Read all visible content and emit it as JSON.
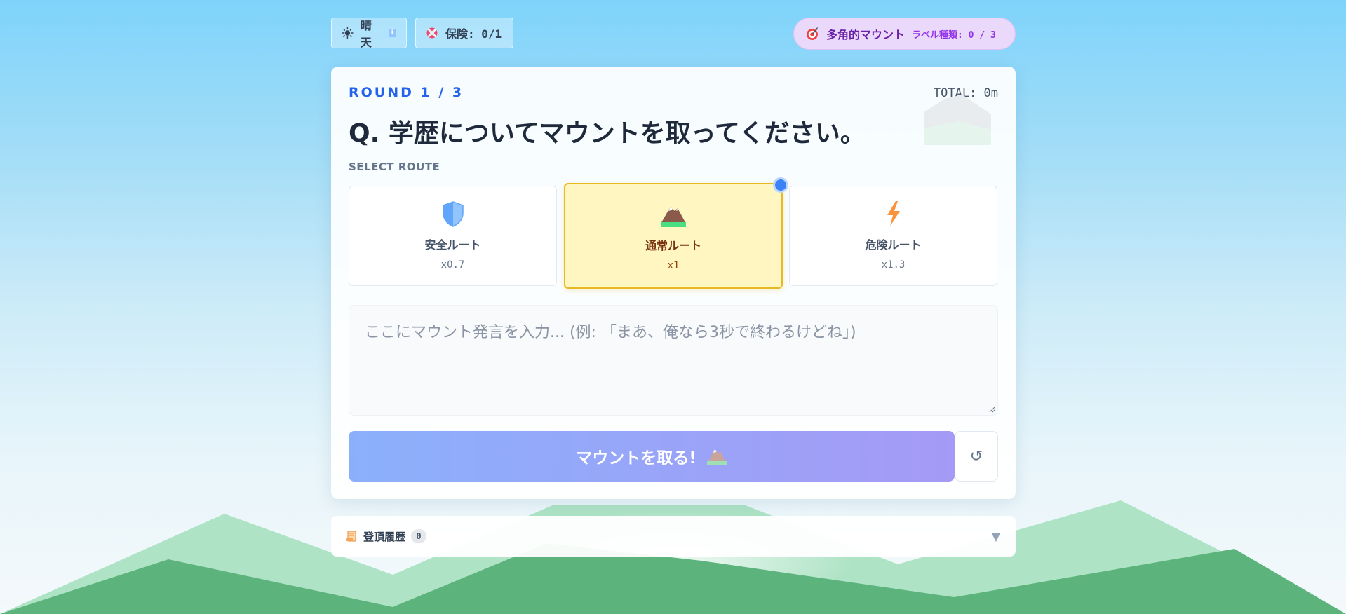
{
  "topbar": {
    "weather": {
      "icon": "sun-icon",
      "label": "晴天",
      "info_icon": "info-icon"
    },
    "insurance": {
      "icon": "lifebuoy-icon",
      "label": "保険: 0/1"
    },
    "multi": {
      "icon": "target-icon",
      "title": "多角的マウント",
      "sub": "ラベル種類: 0 / 3"
    }
  },
  "card": {
    "round": "ROUND 1 / 3",
    "total": "TOTAL: 0m",
    "question": "Q. 学歴についてマウントを取ってください。",
    "select_label": "SELECT ROUTE",
    "routes": [
      {
        "icon": "shield-icon",
        "name": "安全ルート",
        "mult": "x0.7",
        "selected": false
      },
      {
        "icon": "mountain-icon",
        "name": "通常ルート",
        "mult": "x1",
        "selected": true
      },
      {
        "icon": "lightning-icon",
        "name": "危険ルート",
        "mult": "x1.3",
        "selected": false
      }
    ],
    "input": {
      "value": "",
      "placeholder": "ここにマウント発言を入力... (例: 「まあ、俺なら3秒で終わるけどね」)"
    },
    "submit_label": "マウントを取る!",
    "submit_icon": "mountain-icon",
    "reset_label": "↺"
  },
  "history": {
    "icon": "scroll-icon",
    "title": "登頂履歴",
    "count": "0",
    "chevron": "▼"
  },
  "colors": {
    "accent": "#2563eb",
    "selected_route_bg": "#fff6c2",
    "selected_route_border": "#e8b923",
    "submit_gradient_start": "#8bb0fb",
    "submit_gradient_end": "#a59af5",
    "multi_pill_bg": "#ead9fb"
  }
}
